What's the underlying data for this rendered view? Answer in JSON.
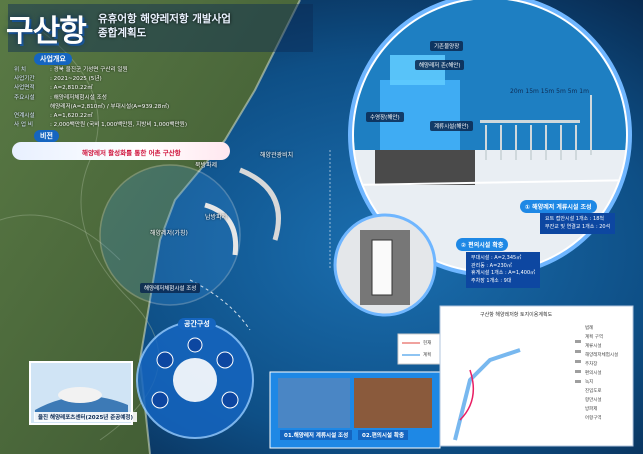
{
  "title": "구산항",
  "subtitle": {
    "line1": "유휴어항 해양레저항 개발사업",
    "line2": "종합계획도"
  },
  "overview": {
    "heading": "사업개요",
    "rows": [
      {
        "key": "위 치",
        "value": ": 경북 울진군 기성면 구산리 일원"
      },
      {
        "key": "사업기간",
        "value": ": 2021~2025 (5년)"
      },
      {
        "key": "사업면적",
        "value": ": A=2,810.22㎡"
      },
      {
        "key": "주요시설",
        "value": ": 해양레저체험시설 조성"
      },
      {
        "key": "",
        "value": "해양레저(A=2,810㎡) / 부대시설(A=939.28㎡)"
      },
      {
        "key": "연계시설",
        "value": ": A=1,620.22㎡"
      },
      {
        "key": "사 업 비",
        "value": ": 2,000백만원 (국비 1,000백만원, 지방비 1,000백만원)"
      }
    ]
  },
  "vision": {
    "heading": "비전",
    "text": "해양레저 활성화를 통한 어촌 구산항"
  },
  "map_labels": {
    "south_breakwater": "남방파제",
    "north_breakwater": "북방파제",
    "facility_zone": "해양레저체험시설 조성",
    "water_zone": "해양레저(가칭)",
    "connection": "해양관광비치"
  },
  "detail_labels": {
    "existing_pier": "기존물양장",
    "fish_zone": "해양레저 존(해안)",
    "pier_label": "계류시설(해안)",
    "leisure_pool": "수영장(해안)",
    "dims": [
      "20m",
      "15m",
      "15m",
      "5m",
      "5m",
      "1m"
    ]
  },
  "sections": {
    "s1": {
      "label": "① 해양레저 계류시설 조성",
      "desc": [
        "요트 접안시설 1개소 : 18척",
        "부잔교 및 연결교 1개소 : 20석"
      ]
    },
    "s2": {
      "label": "② 편의시설 확충",
      "desc": [
        "부대시설 : A=2,345㎡",
        "관리동 : A=230㎡",
        "휴게시설 1개소 : A=1,400㎡",
        "주차장 1개소 : 9대"
      ]
    }
  },
  "space_concept": {
    "heading": "공간구성"
  },
  "photo_caption": "울진 해양레포츠센터(2025년 준공예정)",
  "bottom_captions": [
    "01.해양레저 계류시설 조성",
    "02.편의시설 확충"
  ],
  "plan_sheet": {
    "title": "구산항 해양레저항 토지이용계획도",
    "legend": [
      "범례",
      "계획 구역",
      "계류시설",
      "해양레저체험시설",
      "주차장",
      "편의시설",
      "녹지",
      "진입도로",
      "항만시설",
      "방파제",
      "어항구역"
    ]
  },
  "small_legend": [
    "현재",
    "계획"
  ],
  "colors": {
    "sea": "#0e4f86",
    "deep": "#0a2d55",
    "land": "#4d6b3a",
    "accent": "#1e88e5",
    "vision_red": "#d0143c"
  }
}
